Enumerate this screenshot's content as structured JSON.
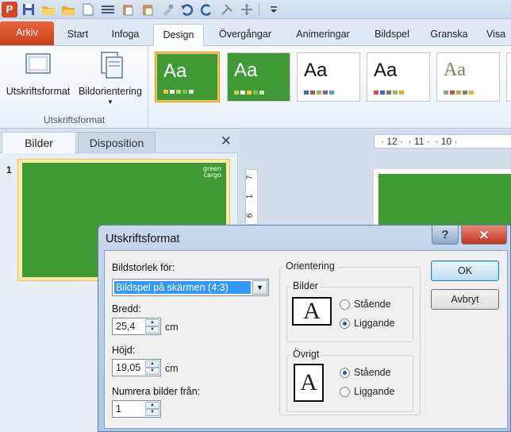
{
  "app": {
    "icon_letter": "P"
  },
  "tabs": [
    {
      "label": "Arkiv",
      "active": false
    },
    {
      "label": "Start",
      "active": false
    },
    {
      "label": "Infoga",
      "active": false
    },
    {
      "label": "Design",
      "active": true
    },
    {
      "label": "Övergångar",
      "active": false
    },
    {
      "label": "Animeringar",
      "active": false
    },
    {
      "label": "Bildspel",
      "active": false
    },
    {
      "label": "Granska",
      "active": false
    },
    {
      "label": "Visa",
      "active": false
    }
  ],
  "ribbon": {
    "page_setup_label": "Utskriftsformat",
    "orientation_label": "Bildorientering",
    "group_label": "Utskriftsformat",
    "theme_sample": "Aa"
  },
  "pane": {
    "tab_slides": "Bilder",
    "tab_outline": "Disposition",
    "slide_number": "1",
    "logo_line1": "green",
    "logo_line2": "cargo"
  },
  "ruler": {
    "horizontal": "· 12 ·  · 11 ·  · 10 ·",
    "vertical_1": "7",
    "vertical_2": "1",
    "vertical_3": "6"
  },
  "dialog": {
    "title": "Utskriftsformat",
    "help": "?",
    "slide_size_label": "Bildstorlek för:",
    "slide_size_value": "Bildspel på skärmen (4:3)",
    "width_label": "Bredd:",
    "width_value": "25,4",
    "width_unit": "cm",
    "height_label": "Höjd:",
    "height_value": "19,05",
    "height_unit": "cm",
    "number_from_label": "Numrera bilder från:",
    "number_from_value": "1",
    "orientation_label": "Orientering",
    "slides_group": "Bilder",
    "other_group": "Övrigt",
    "portrait": "Stående",
    "landscape": "Liggande",
    "page_letter": "A",
    "ok": "OK",
    "cancel": "Avbryt"
  },
  "colors": {
    "accent": "#3f9a35",
    "file_tab": "#d24726"
  }
}
